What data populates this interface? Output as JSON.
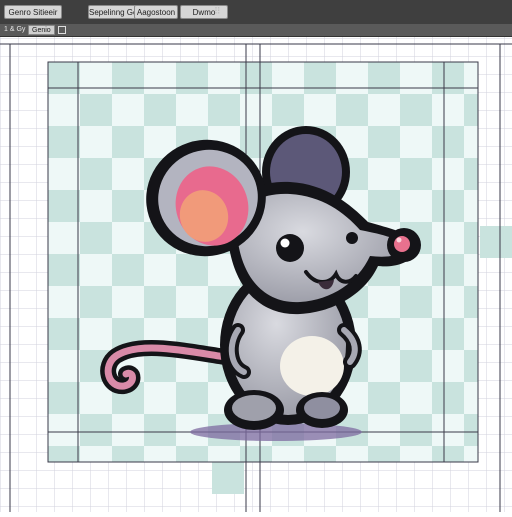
{
  "toolbar": {
    "buttons": [
      {
        "label": "Genro Sitieeir"
      },
      {
        "label": "Sepelinng Genro"
      },
      {
        "label": "Aagostoon"
      },
      {
        "label": "Dwmo"
      }
    ],
    "dots": "⠿"
  },
  "subbar": {
    "items": [
      {
        "label": "1 & Gy"
      },
      {
        "label": "Genio"
      },
      {
        "label": ""
      }
    ]
  },
  "colors": {
    "toolbar_bg": "#3f3f3f",
    "checker_a": "#c9e3de",
    "checker_b": "#eef8f7",
    "grid_line": "#c8c8d4",
    "mouse_body": "#b6b7c0",
    "ear_inner": "#e86a8e",
    "outline": "#141418"
  }
}
